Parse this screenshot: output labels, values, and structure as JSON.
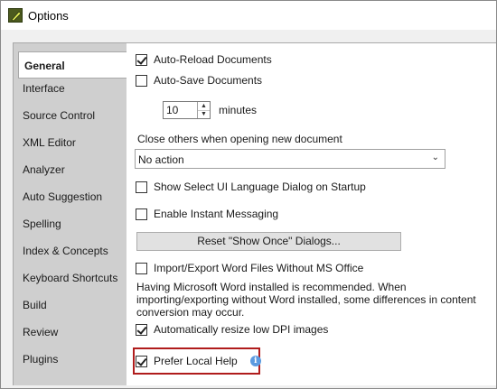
{
  "window": {
    "title": "Options",
    "app_icon": "pencil-app-icon"
  },
  "sidebar": {
    "items": [
      {
        "label": "General",
        "active": true
      },
      {
        "label": "Interface"
      },
      {
        "label": "Source Control"
      },
      {
        "label": "XML Editor"
      },
      {
        "label": "Analyzer"
      },
      {
        "label": "Auto Suggestion"
      },
      {
        "label": "Spelling"
      },
      {
        "label": "Index & Concepts"
      },
      {
        "label": "Keyboard Shortcuts"
      },
      {
        "label": "Build"
      },
      {
        "label": "Review"
      },
      {
        "label": "Plugins"
      }
    ]
  },
  "general": {
    "auto_reload": {
      "label": "Auto-Reload Documents",
      "checked": true
    },
    "auto_save": {
      "label": "Auto-Save Documents",
      "checked": false
    },
    "save_interval": {
      "value": "10",
      "unit": "minutes"
    },
    "close_others_label": "Close others when opening new document",
    "close_others_value": "No action",
    "show_language_dialog": {
      "label": "Show Select UI Language Dialog on Startup",
      "checked": false
    },
    "instant_messaging": {
      "label": "Enable Instant Messaging",
      "checked": false
    },
    "reset_button": "Reset \"Show Once\" Dialogs...",
    "import_export_word": {
      "label": "Import/Export Word Files Without MS Office",
      "checked": false
    },
    "word_note": "Having Microsoft Word installed is recommended. When importing/exporting without Word installed, some differences in content conversion may occur.",
    "resize_low_dpi": {
      "label": "Automatically resize low DPI images",
      "checked": true
    },
    "prefer_local_help": {
      "label": "Prefer Local Help",
      "checked": true,
      "info_icon": "info-icon"
    }
  },
  "colors": {
    "highlight_border": "#b01c1c",
    "info_icon": "#5d9be0"
  }
}
